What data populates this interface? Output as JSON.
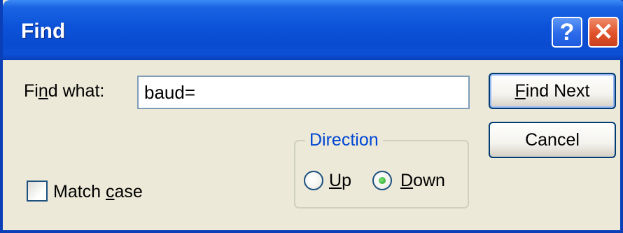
{
  "window": {
    "title": "Find",
    "help_label": "?",
    "close_label": "✕"
  },
  "find": {
    "label_pre": "Fi",
    "label_underline": "n",
    "label_post": "d what:",
    "value": "baud="
  },
  "buttons": {
    "find_next_underline": "F",
    "find_next_rest": "ind Next",
    "cancel": "Cancel"
  },
  "direction": {
    "label": "Direction",
    "up_underline": "U",
    "up_rest": "p",
    "down_underline": "D",
    "down_rest": "own",
    "selected": "Down"
  },
  "match_case": {
    "label_pre": "Match ",
    "label_underline": "c",
    "label_post": "ase",
    "checked": false
  },
  "colors": {
    "titlebar": "#0b52d8",
    "dialog_bg": "#ece9d8",
    "group_label": "#0046d5",
    "close_button": "#e0512a"
  }
}
